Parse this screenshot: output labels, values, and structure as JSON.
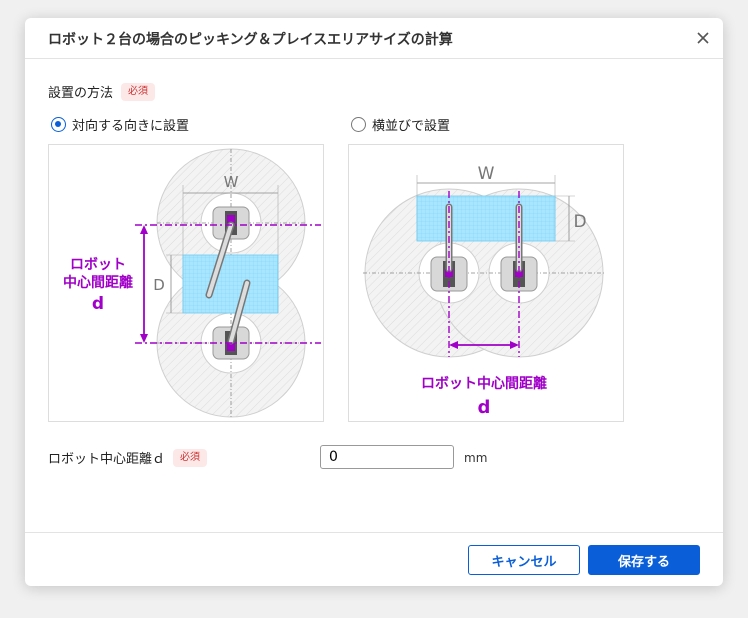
{
  "dialog": {
    "title": "ロボット２台の場合のピッキング＆プレイスエリアサイズの計算",
    "close_icon": "close-icon"
  },
  "method": {
    "label": "設置の方法",
    "required_badge": "必須",
    "options": [
      {
        "label": "対向する向きに設置",
        "selected": true
      },
      {
        "label": "横並びで設置",
        "selected": false
      }
    ]
  },
  "diagram_facing": {
    "width_label": "W",
    "depth_label": "D",
    "distance_label_line1": "ロボット",
    "distance_label_line2": "中心間距離",
    "distance_label_line3": "d"
  },
  "diagram_side": {
    "width_label": "W",
    "depth_label": "D",
    "distance_label_line1": "ロボット中心間距離",
    "distance_label_line2": "d"
  },
  "distance": {
    "label": "ロボット中心距離ｄ",
    "required_badge": "必須",
    "value": "0",
    "unit": "mm"
  },
  "footer": {
    "cancel_label": "キャンセル",
    "save_label": "保存する"
  },
  "colors": {
    "accent": "#0a5fd8",
    "distance_marker": "#a000c8",
    "area_fill": "#9fe3ff",
    "required_bg": "#fde8e8"
  }
}
